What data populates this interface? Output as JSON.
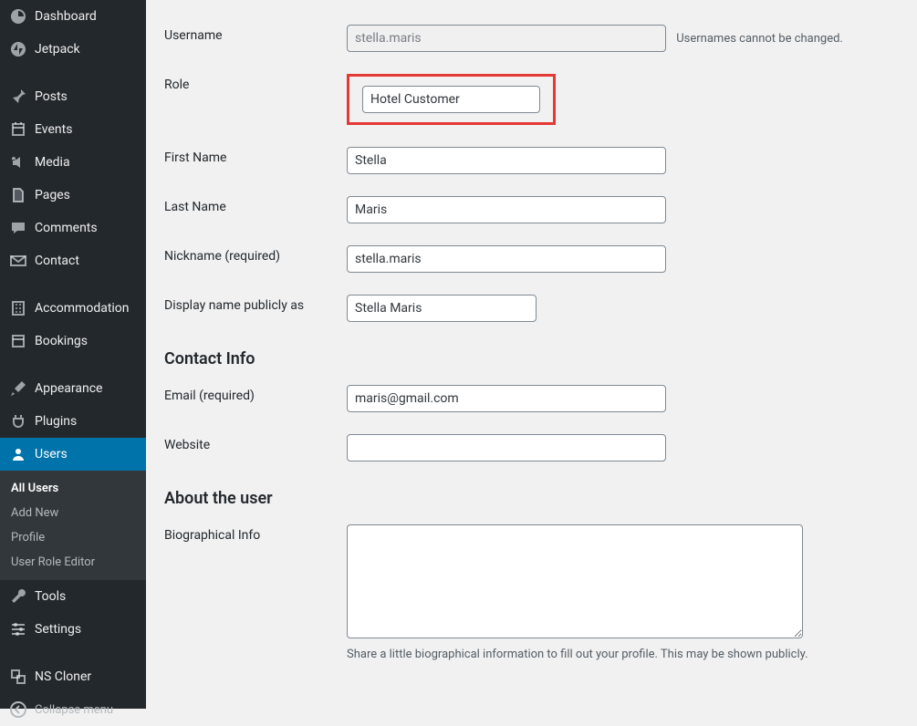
{
  "sidebar": {
    "items": [
      {
        "label": "Dashboard"
      },
      {
        "label": "Jetpack"
      },
      {
        "label": "Posts"
      },
      {
        "label": "Events"
      },
      {
        "label": "Media"
      },
      {
        "label": "Pages"
      },
      {
        "label": "Comments"
      },
      {
        "label": "Contact"
      },
      {
        "label": "Accommodation"
      },
      {
        "label": "Bookings"
      },
      {
        "label": "Appearance"
      },
      {
        "label": "Plugins"
      },
      {
        "label": "Users"
      },
      {
        "label": "Tools"
      },
      {
        "label": "Settings"
      },
      {
        "label": "NS Cloner"
      }
    ],
    "submenu": {
      "all_users": "All Users",
      "add_new": "Add New",
      "profile": "Profile",
      "user_role_editor": "User Role Editor"
    },
    "collapse": "Collapse menu"
  },
  "form": {
    "username_label": "Username",
    "username_value": "stella.maris",
    "username_note": "Usernames cannot be changed.",
    "role_label": "Role",
    "role_value": "Hotel Customer",
    "first_name_label": "First Name",
    "first_name_value": "Stella",
    "last_name_label": "Last Name",
    "last_name_value": "Maris",
    "nickname_label": "Nickname (required)",
    "nickname_value": "stella.maris",
    "display_label": "Display name publicly as",
    "display_value": "Stella Maris",
    "contact_heading": "Contact Info",
    "email_label": "Email (required)",
    "email_value": "maris@gmail.com",
    "website_label": "Website",
    "website_value": "",
    "about_heading": "About the user",
    "bio_label": "Biographical Info",
    "bio_value": "",
    "bio_description": "Share a little biographical information to fill out your profile. This may be shown publicly."
  }
}
